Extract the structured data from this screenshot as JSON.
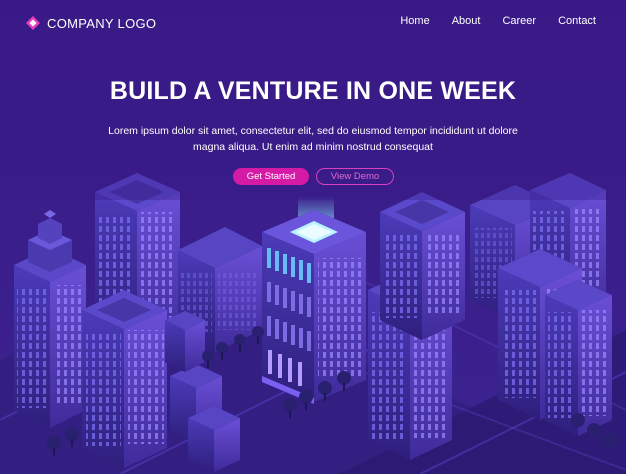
{
  "header": {
    "logo_text": "COMPANY LOGO",
    "logo_icon": "diamond-icon",
    "nav": [
      {
        "label": "Home"
      },
      {
        "label": "About"
      },
      {
        "label": "Career"
      },
      {
        "label": "Contact"
      }
    ]
  },
  "hero": {
    "title": "BUILD A VENTURE IN ONE WEEK",
    "subtitle": "Lorem ipsum dolor sit amet, consectetur elit, sed do eiusmod tempor incididunt ut dolore magna aliqua. Ut enim ad minim nostrud consequat",
    "primary_button": "Get Started",
    "secondary_button": "View Demo"
  },
  "colors": {
    "background": "#3d1f8c",
    "accent": "#d51ba6",
    "accent_outline": "#d93fbf",
    "glow": "#5fd0ff"
  }
}
